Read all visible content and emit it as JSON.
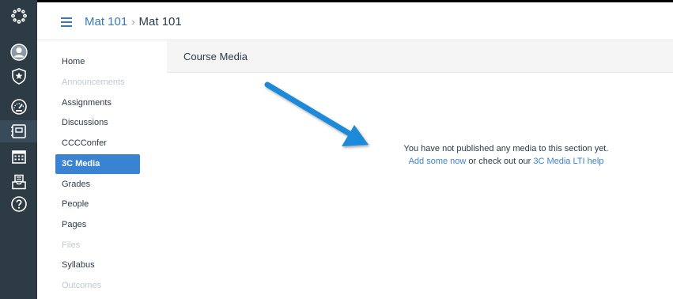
{
  "global_nav": {
    "items": [
      {
        "name": "logo",
        "icon": "canvas-logo-icon"
      },
      {
        "name": "account",
        "icon": "user-avatar-icon"
      },
      {
        "name": "admin",
        "icon": "shield-star-icon"
      },
      {
        "name": "dashboard",
        "icon": "speedometer-icon"
      },
      {
        "name": "courses",
        "icon": "courses-icon",
        "active": true
      },
      {
        "name": "calendar",
        "icon": "calendar-icon"
      },
      {
        "name": "inbox",
        "icon": "inbox-icon"
      },
      {
        "name": "help",
        "icon": "help-icon"
      }
    ],
    "colors": {
      "background": "#2d3b45",
      "icon": "#ffffff",
      "active": "#394b58"
    }
  },
  "header": {
    "menu_icon": "hamburger-icon",
    "breadcrumb": {
      "course": "Mat 101",
      "separator": "›",
      "current": "Mat 101"
    }
  },
  "course_nav": {
    "items": [
      {
        "label": "Home",
        "state": "normal"
      },
      {
        "label": "Announcements",
        "state": "disabled"
      },
      {
        "label": "Assignments",
        "state": "normal"
      },
      {
        "label": "Discussions",
        "state": "normal"
      },
      {
        "label": "CCCConfer",
        "state": "normal"
      },
      {
        "label": "3C Media",
        "state": "active"
      },
      {
        "label": "Grades",
        "state": "normal"
      },
      {
        "label": "People",
        "state": "normal"
      },
      {
        "label": "Pages",
        "state": "normal"
      },
      {
        "label": "Files",
        "state": "disabled"
      },
      {
        "label": "Syllabus",
        "state": "normal"
      },
      {
        "label": "Outcomes",
        "state": "disabled"
      }
    ],
    "active_color": "#3a83d2"
  },
  "content": {
    "title": "Course Media",
    "message": "You have not published any media to this section yet.",
    "add_link": "Add some now",
    "middle_text": " or check out our ",
    "help_link": "3C Media LTI help",
    "annotation": "arrow-pointer-icon",
    "annotation_color": "#1c8ad9"
  }
}
